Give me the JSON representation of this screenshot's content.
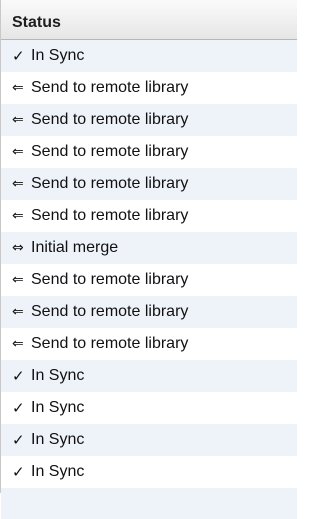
{
  "column": {
    "header": "Status"
  },
  "icons": {
    "check": "✓",
    "send": "⇐",
    "merge": "⇔"
  },
  "rows": [
    {
      "icon": "check",
      "symbol": "✓",
      "label": "In Sync"
    },
    {
      "icon": "send",
      "symbol": "⇐",
      "label": "Send to remote library"
    },
    {
      "icon": "send",
      "symbol": "⇐",
      "label": "Send to remote library"
    },
    {
      "icon": "send",
      "symbol": "⇐",
      "label": "Send to remote library"
    },
    {
      "icon": "send",
      "symbol": "⇐",
      "label": "Send to remote library"
    },
    {
      "icon": "send",
      "symbol": "⇐",
      "label": "Send to remote library"
    },
    {
      "icon": "merge",
      "symbol": "⇔",
      "label": "Initial merge"
    },
    {
      "icon": "send",
      "symbol": "⇐",
      "label": "Send to remote library"
    },
    {
      "icon": "send",
      "symbol": "⇐",
      "label": "Send to remote library"
    },
    {
      "icon": "send",
      "symbol": "⇐",
      "label": "Send to remote library"
    },
    {
      "icon": "check",
      "symbol": "✓",
      "label": "In Sync"
    },
    {
      "icon": "check",
      "symbol": "✓",
      "label": "In Sync"
    },
    {
      "icon": "check",
      "symbol": "✓",
      "label": "In Sync"
    },
    {
      "icon": "check",
      "symbol": "✓",
      "label": "In Sync"
    }
  ],
  "colors": {
    "row_alternate": "#eef3fa",
    "row_base": "#ffffff",
    "header_border": "#b7b7b7"
  }
}
